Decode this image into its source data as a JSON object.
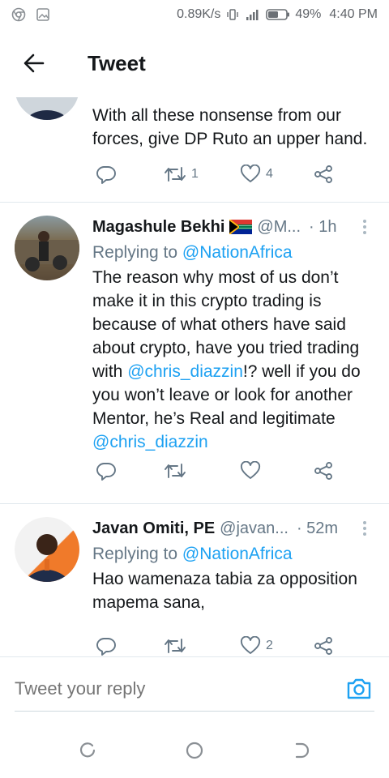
{
  "status_bar": {
    "network_speed": "0.89K/s",
    "battery": "49%",
    "time": "4:40 PM"
  },
  "header": {
    "title": "Tweet"
  },
  "tweets": [
    {
      "text": "With all these nonsense from our forces, give DP Ruto an upper hand.",
      "retweets": "1",
      "likes": "4"
    },
    {
      "name": "Magashule Bekhi",
      "handle": "@M...",
      "time": "· 1h",
      "reply_prefix": "Replying to",
      "reply_to": "@NationAfrica",
      "text_1": "The reason why most of us don’t make it in this crypto trading is because of what others have said about crypto, have you tried trading with ",
      "mention_1": "@chris_diazzin",
      "text_2": "!? well if you do you won’t leave or look for another Mentor, he’s Real and legitimate ",
      "mention_2": "@chris_diazzin"
    },
    {
      "name": "Javan Omiti, PE",
      "handle": "@javan...",
      "time": "· 52m",
      "reply_prefix": "Replying to",
      "reply_to": "@NationAfrica",
      "text": "Hao wamenaza tabia za opposition mapema sana,",
      "likes": "2"
    }
  ],
  "reply_bar": {
    "placeholder": "Tweet your reply"
  },
  "colors": {
    "accent": "#1da1f2",
    "secondary_text": "#657786",
    "divider": "#e1e8ed"
  },
  "icons": [
    "back-arrow-icon",
    "reply-icon",
    "retweet-icon",
    "like-icon",
    "share-icon",
    "more-vertical-icon",
    "camera-icon",
    "flag-icon"
  ]
}
